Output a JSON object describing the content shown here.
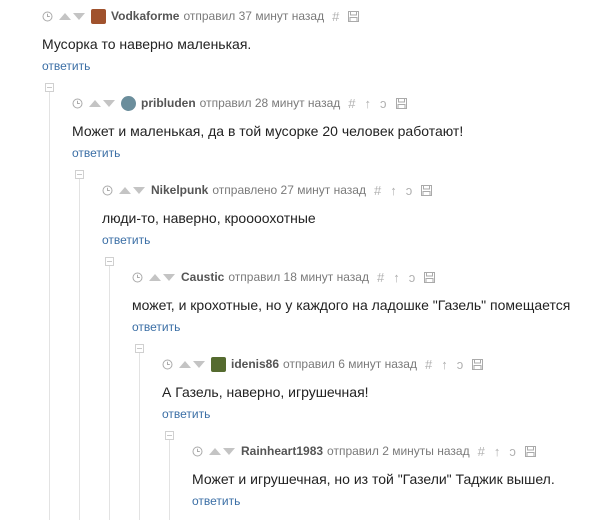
{
  "reply_label": "ответить",
  "comments": [
    {
      "author": "Vodkaforme",
      "time": "отправил 37 минут назад",
      "text": "Мусорка то наверно маленькая.",
      "has_avatar": true,
      "avatar_color": "#a0522d"
    },
    {
      "author": "pribluden",
      "time": "отправил 28 минут назад",
      "text": "Может и маленькая, да в той мусорке 20 человек работают!",
      "has_avatar": true,
      "avatar_color": "#6b8e9c"
    },
    {
      "author": "Nikelpunk",
      "time": "отправлено 27 минут назад",
      "text": "люди-то, наверно, кроооохотные",
      "has_avatar": false
    },
    {
      "author": "Caustic",
      "time": "отправил 18 минут назад",
      "text": "может, и крохотные, но у каждого на ладошке \"Газель\" помещается",
      "has_avatar": false
    },
    {
      "author": "idenis86",
      "time": "отправил 6 минут назад",
      "text": "А Газель, наверно, игрушечная!",
      "has_avatar": true,
      "avatar_color": "#556b2f"
    },
    {
      "author": "Rainheart1983",
      "time": "отправил 2 минуты назад",
      "text": "Может и игрушечная, но из той \"Газели\" Таджик вышел.",
      "has_avatar": false
    }
  ],
  "icons": {
    "clock": "clock-icon",
    "vote_up": "arrow-up-icon",
    "vote_down": "arrow-down-icon",
    "link": "hash-link-icon",
    "parent": "parent-arrow-icon",
    "branch": "branch-icon",
    "save": "save-icon"
  }
}
